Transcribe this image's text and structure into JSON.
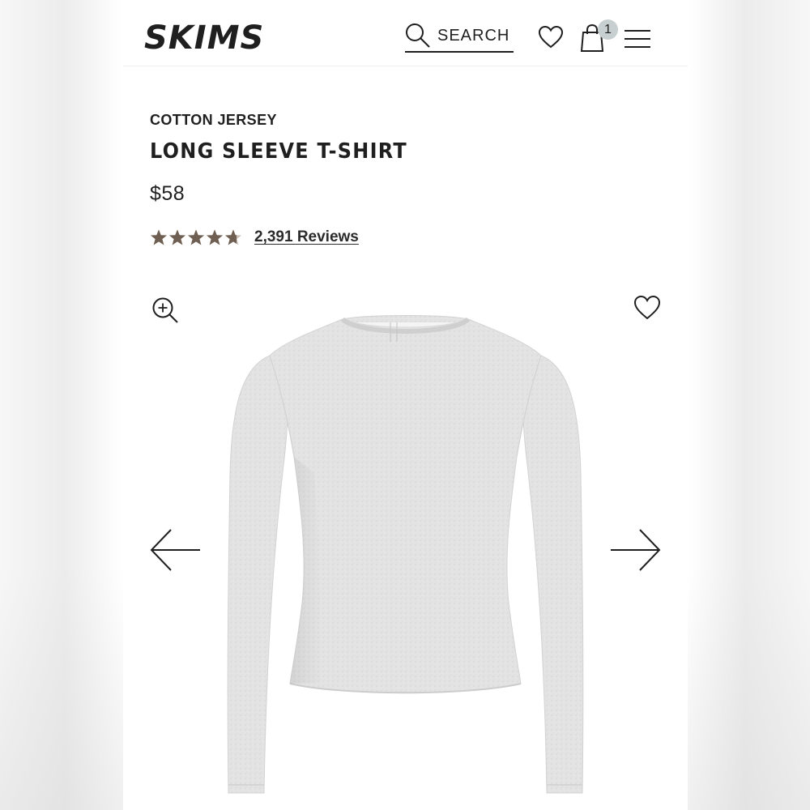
{
  "header": {
    "brand": "SKIMS",
    "search_label": "SEARCH",
    "cart_count": "1"
  },
  "product": {
    "collection": "COTTON JERSEY",
    "name": "LONG SLEEVE T-SHIRT",
    "price": "$58",
    "rating": 4.7,
    "reviews_label": "2,391 Reviews"
  },
  "icons": {
    "search": "search-icon",
    "wishlist": "heart-icon",
    "cart": "shopping-bag-icon",
    "menu": "hamburger-menu-icon",
    "zoom": "zoom-in-icon",
    "save": "heart-icon",
    "prev": "arrow-left-icon",
    "next": "arrow-right-icon"
  },
  "colors": {
    "text": "#1f1f1f",
    "star": "#6e5f52",
    "badge": "#c8cfd0",
    "shirt": "#e2e2e2"
  }
}
